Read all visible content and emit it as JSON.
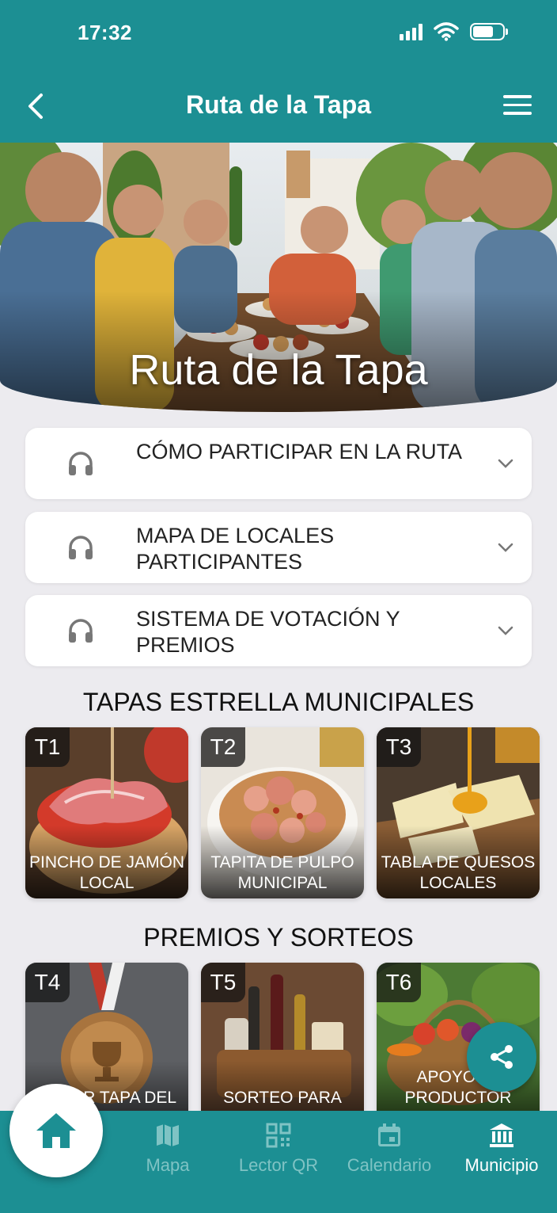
{
  "status_bar": {
    "time": "17:32"
  },
  "header": {
    "title": "Ruta de la Tapa"
  },
  "hero": {
    "title": "Ruta de la Tapa"
  },
  "accordion": [
    {
      "label": "CÓMO PARTICIPAR EN LA RUTA",
      "icon": "headphones-icon"
    },
    {
      "label": "MAPA DE LOCALES PARTICIPANTES",
      "icon": "headphones-icon"
    },
    {
      "label": "SISTEMA DE VOTACIÓN Y PREMIOS",
      "icon": "headphones-icon"
    }
  ],
  "sections": {
    "tapas_title": "TAPAS ESTRELLA MUNICIPALES",
    "premios_title": "PREMIOS Y SORTEOS"
  },
  "tapas": [
    {
      "tag": "T1",
      "caption": "PINCHO DE JAMÓN LOCAL"
    },
    {
      "tag": "T2",
      "caption": "TAPITA DE PULPO MUNICIPAL"
    },
    {
      "tag": "T3",
      "caption": "TABLA DE QUESOS LOCALES"
    }
  ],
  "premios": [
    {
      "tag": "T4",
      "caption": "MEJOR TAPA DEL MUNICIPIO"
    },
    {
      "tag": "T5",
      "caption": "SORTEO PARA VOTANTES"
    },
    {
      "tag": "T6",
      "caption": "APOYO AL PRODUCTOR LOCAL"
    }
  ],
  "bottom_nav": {
    "items": [
      {
        "label": "Mapa",
        "icon": "map-icon"
      },
      {
        "label": "Lector QR",
        "icon": "qr-code-icon"
      },
      {
        "label": "Calendario",
        "icon": "calendar-icon"
      },
      {
        "label": "Municipio",
        "icon": "municipal-building-icon"
      }
    ],
    "home_icon": "home-icon"
  },
  "colors": {
    "primary": "#1c8f93",
    "background": "#ecebef",
    "nav_inactive": "#7fc3c4"
  }
}
